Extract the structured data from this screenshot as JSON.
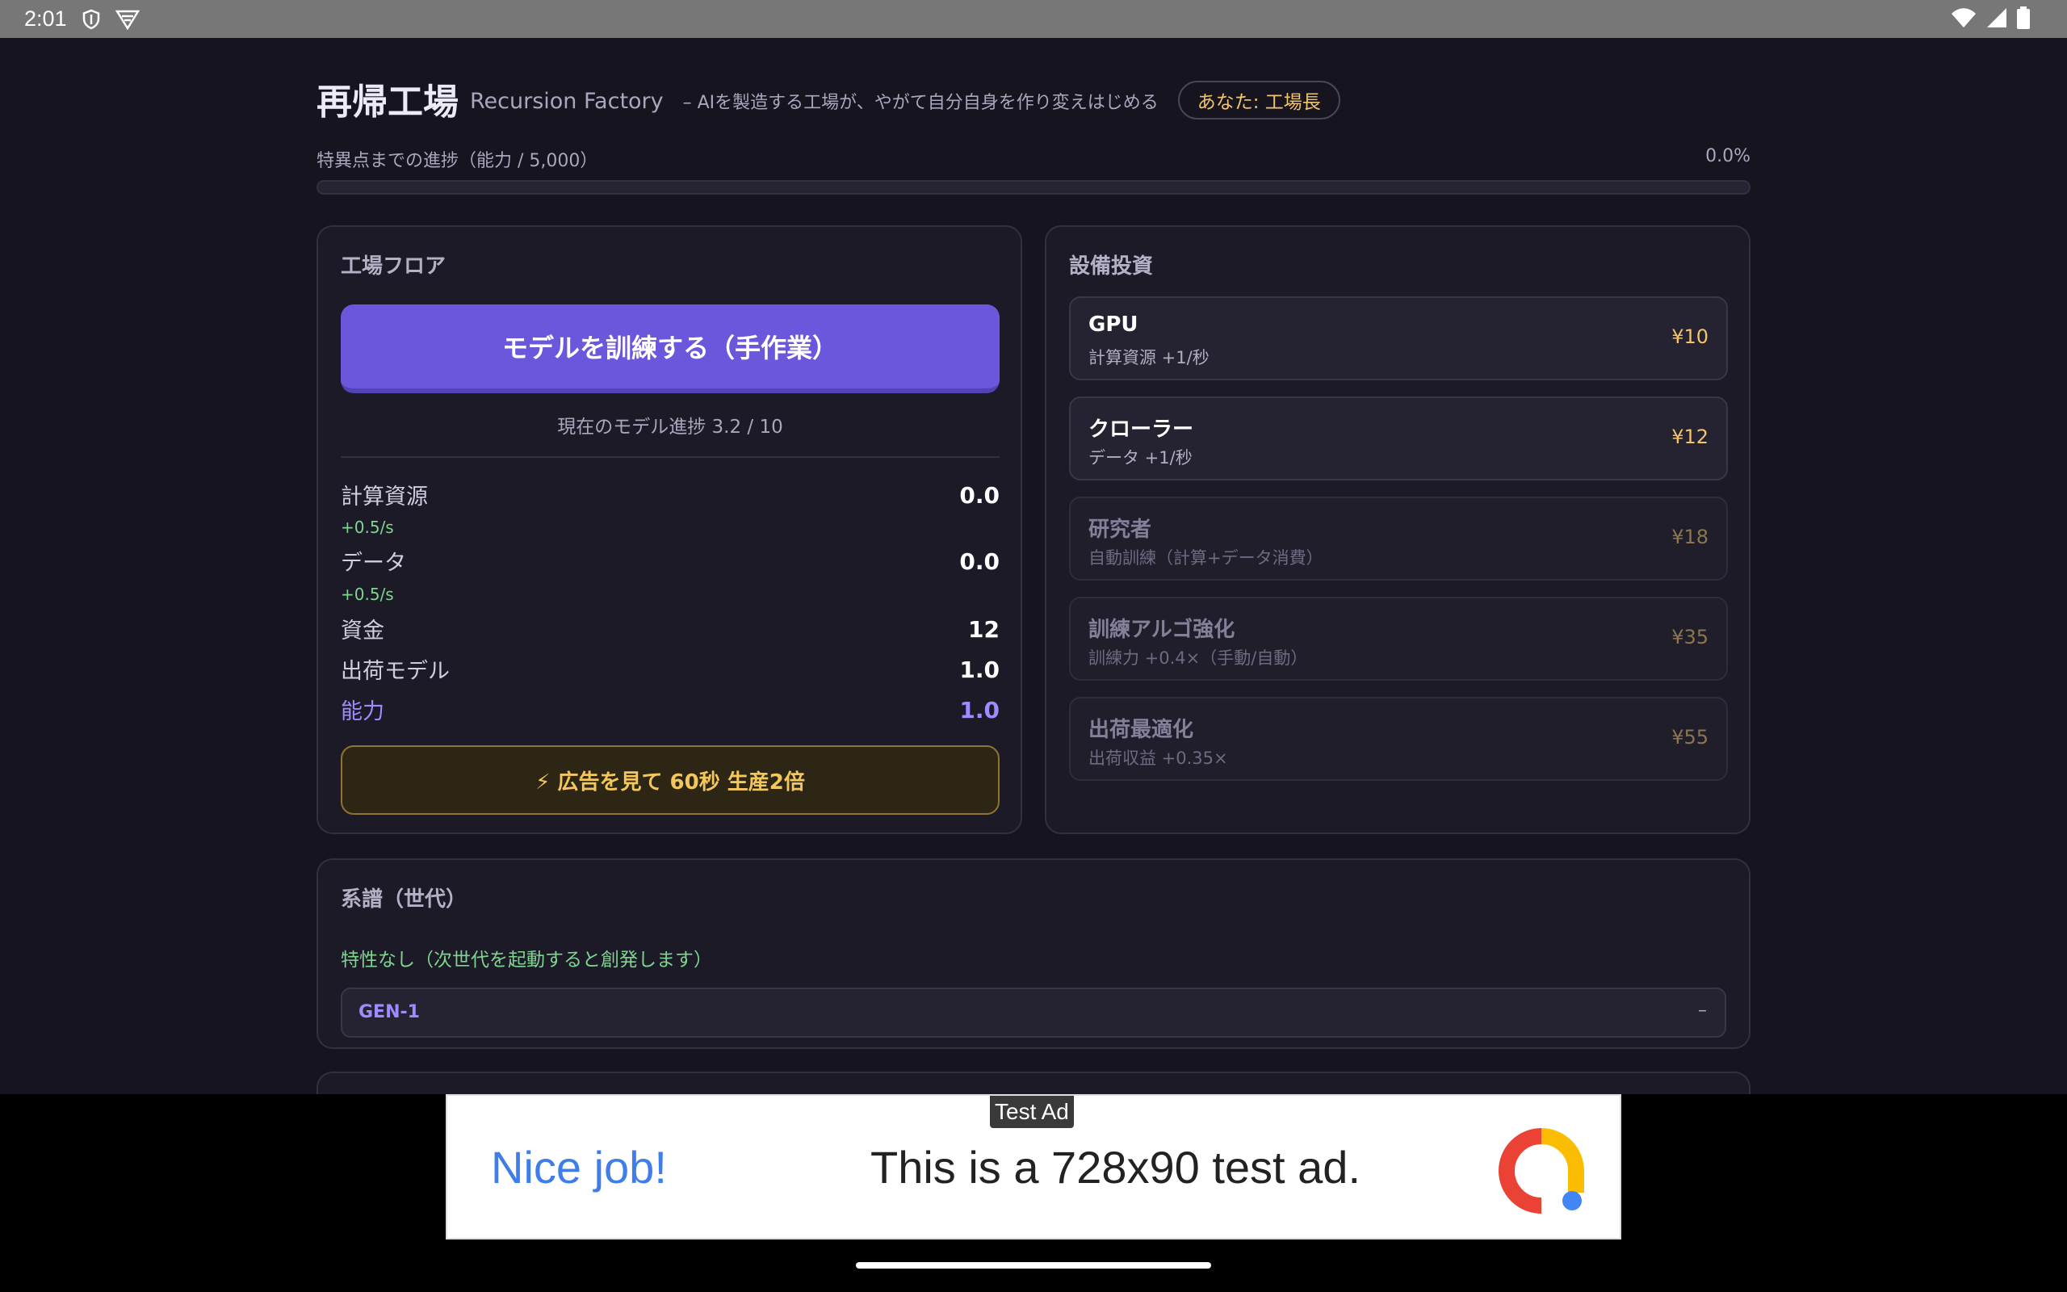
{
  "status_bar": {
    "time": "2:01",
    "left_icons": [
      "shield-icon",
      "vpn-icon"
    ],
    "right_icons": [
      "wifi-icon",
      "signal-icon",
      "battery-icon"
    ]
  },
  "header": {
    "title_jp": "再帰工場",
    "title_en": "Recursion Factory",
    "tagline": "– AIを製造する工場が、やがて自分自身を作り変えはじめる",
    "role_badge": "あなた: 工場長"
  },
  "singularity_progress": {
    "label": "特異点までの進捗（能力 / 5,000）",
    "percent_text": "0.0%",
    "fraction": 0.0
  },
  "factory_floor": {
    "title": "工場フロア",
    "train_button": "モデルを訓練する（手作業）",
    "model_progress": "現在のモデル進捗 3.2 / 10",
    "stats": [
      {
        "label": "計算資源",
        "value": "0.0",
        "rate": "+0.5/s"
      },
      {
        "label": "データ",
        "value": "0.0",
        "rate": "+0.5/s"
      },
      {
        "label": "資金",
        "value": "12"
      },
      {
        "label": "出荷モデル",
        "value": "1.0"
      },
      {
        "label": "能力",
        "value": "1.0"
      }
    ],
    "ad_boost_button": "⚡ 広告を見て 60秒 生産2倍"
  },
  "equipment": {
    "title": "設備投資",
    "items": [
      {
        "name": "GPU",
        "desc": "計算資源 +1/秒",
        "price": "¥10",
        "enabled": true
      },
      {
        "name": "クローラー",
        "desc": "データ +1/秒",
        "price": "¥12",
        "enabled": true
      },
      {
        "name": "研究者",
        "desc": "自動訓練（計算+データ消費）",
        "price": "¥18",
        "enabled": false
      },
      {
        "name": "訓練アルゴ強化",
        "desc": "訓練力 +0.4×（手動/自動）",
        "price": "¥35",
        "enabled": false
      },
      {
        "name": "出荷最適化",
        "desc": "出荷収益 +0.35×",
        "price": "¥55",
        "enabled": false
      }
    ]
  },
  "lineage": {
    "title": "系譜（世代）",
    "trait_note": "特性なし（次世代を起動すると創発します）",
    "generations": [
      {
        "label": "GEN-1",
        "detail": "–"
      }
    ]
  },
  "ad_banner": {
    "tag": "Test Ad",
    "headline": "Nice job!",
    "body": "This is a 728x90 test ad.",
    "logo": "admob-logo-icon"
  }
}
